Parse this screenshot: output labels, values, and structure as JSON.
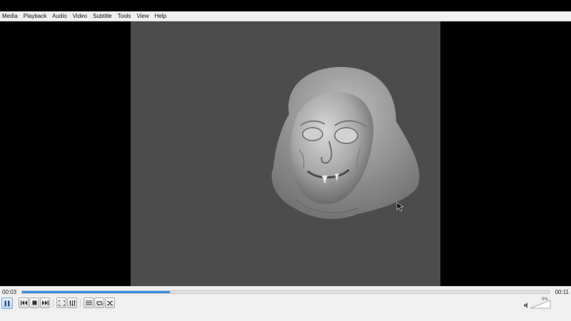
{
  "menubar": {
    "items": [
      {
        "label": "Media"
      },
      {
        "label": "Playback"
      },
      {
        "label": "Audio"
      },
      {
        "label": "Video"
      },
      {
        "label": "Subtitle"
      },
      {
        "label": "Tools"
      },
      {
        "label": "View"
      },
      {
        "label": "Help"
      }
    ]
  },
  "playback": {
    "elapsed": "00:03",
    "total": "00:11",
    "progress_fraction": 0.28,
    "state": "playing"
  },
  "volume": {
    "percent_label": "0%",
    "level_fraction": 0.0
  },
  "controls": {
    "icons": [
      "pause-icon",
      "previous-icon",
      "stop-icon",
      "next-icon",
      "fullscreen-icon",
      "extended-settings-icon",
      "playlist-icon",
      "loop-icon",
      "shuffle-icon",
      "speaker-icon"
    ]
  },
  "colors": {
    "accent": "#3a8ee6",
    "video_background": "#4c4c4c"
  }
}
